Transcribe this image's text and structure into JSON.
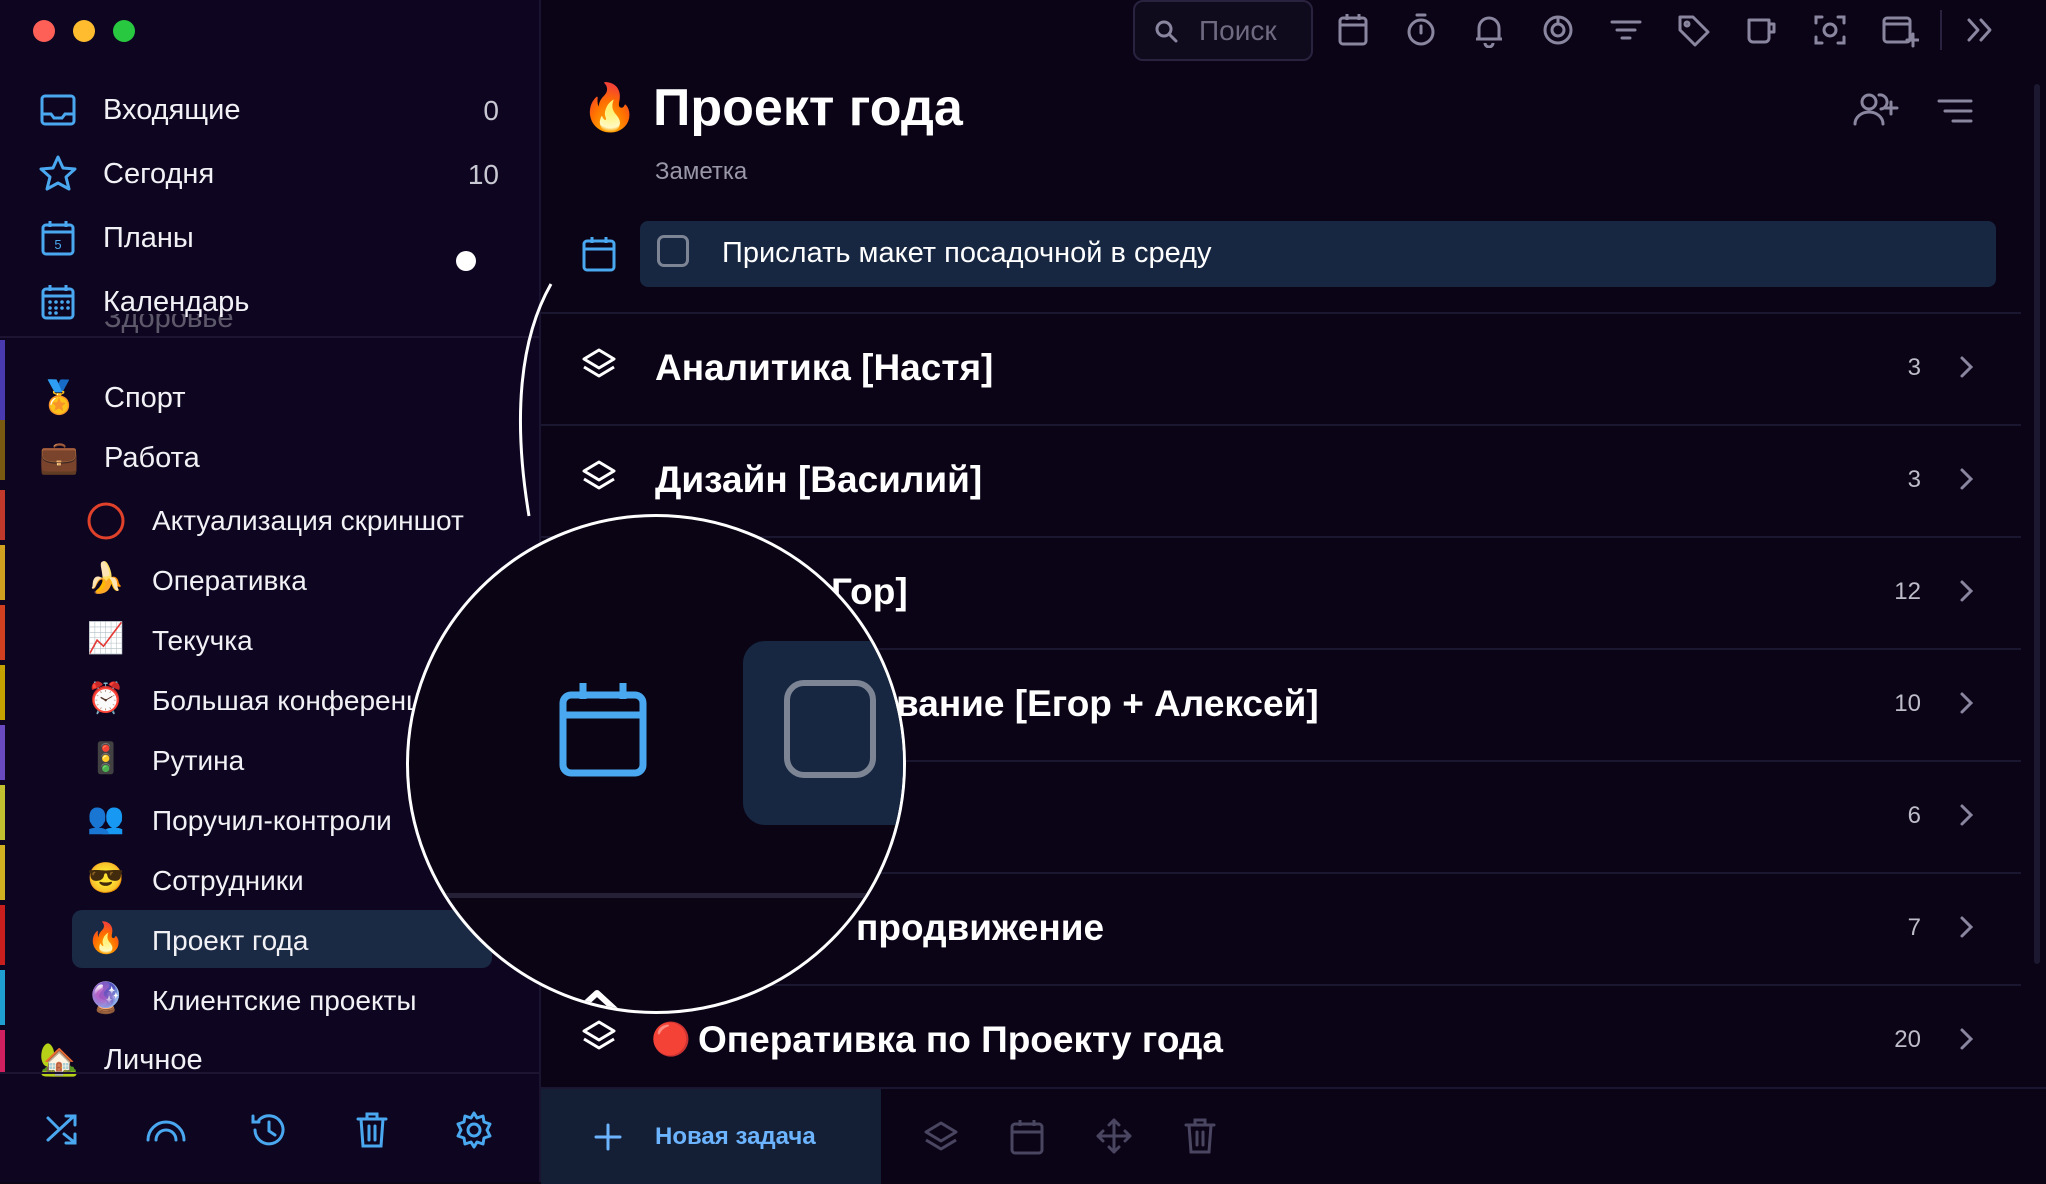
{
  "colors": {
    "accent": "#4aa8f0",
    "sidebar_bg": "#0e0620",
    "main_bg": "#0b0416",
    "active_row": "#1a2944",
    "new_task_text": "#6cb4ff"
  },
  "window": {
    "traffic_lights": [
      "#fe5f57",
      "#febc2e",
      "#28c840"
    ]
  },
  "sidebar": {
    "nav": [
      {
        "label": "Входящие",
        "count": "0",
        "icon": "inbox-icon"
      },
      {
        "label": "Сегодня",
        "count": "10",
        "icon": "star-icon"
      },
      {
        "label": "Планы",
        "count": "",
        "icon": "planner-calendar-icon"
      },
      {
        "label": "Календарь",
        "count": "",
        "icon": "calendar-grid-icon"
      }
    ],
    "partial_item": "Здоровье",
    "areas": [
      {
        "emoji": "🏅",
        "label": "Спорт"
      },
      {
        "emoji": "💼",
        "label": "Работа"
      }
    ],
    "projects": [
      {
        "emoji": "",
        "label": "Актуализация скриншот",
        "icon": "progress-circle-icon"
      },
      {
        "emoji": "🍌",
        "label": "Оперативка"
      },
      {
        "emoji": "📈",
        "label": "Текучка"
      },
      {
        "emoji": "⏰",
        "label": "Большая конференция"
      },
      {
        "emoji": "🚦",
        "label": "Рутина"
      },
      {
        "emoji": "👥",
        "label": "Поручил-контроли"
      },
      {
        "emoji": "😎",
        "label": "Сотрудники"
      },
      {
        "emoji": "🔥",
        "label": "Проект года",
        "active": true
      },
      {
        "emoji": "🔮",
        "label": "Клиентские проекты"
      }
    ],
    "personal": {
      "emoji": "🏡",
      "label": "Личное"
    },
    "bottom_icons": [
      "shuffle-icon",
      "arc-icon",
      "history-icon",
      "trash-icon",
      "gear-icon"
    ]
  },
  "toolbar": {
    "search_placeholder": "Поиск",
    "icons": [
      "calendar-icon",
      "timer-icon",
      "bell-icon",
      "focus-icon",
      "filter-icon",
      "tag-icon",
      "coffee-icon",
      "screenshot-icon",
      "add-window-icon",
      "expand-icon"
    ]
  },
  "project": {
    "emoji": "🔥",
    "title": "Проект года",
    "note": "Заметка",
    "header_icons": [
      "add-member-icon",
      "sort-icon"
    ]
  },
  "task": {
    "label": "Прислать макет посадочной в среду"
  },
  "groups": [
    {
      "label": "Аналитика [Настя]",
      "count": "3"
    },
    {
      "label": "Дизайн [Василий]",
      "count": "3"
    },
    {
      "label": "Гор]",
      "count": "12"
    },
    {
      "label": "вание [Егор + Алексей]",
      "count": "10"
    },
    {
      "label": "",
      "count": "6"
    },
    {
      "label": "продвижение",
      "count": "7"
    },
    {
      "label": "Оперативка по Проекту года",
      "count": "20",
      "badge": "🔴"
    }
  ],
  "bottom_bar": {
    "new_task": "Новая задача",
    "icons": [
      "layers-icon",
      "calendar-icon",
      "move-icon",
      "trash-icon"
    ]
  }
}
